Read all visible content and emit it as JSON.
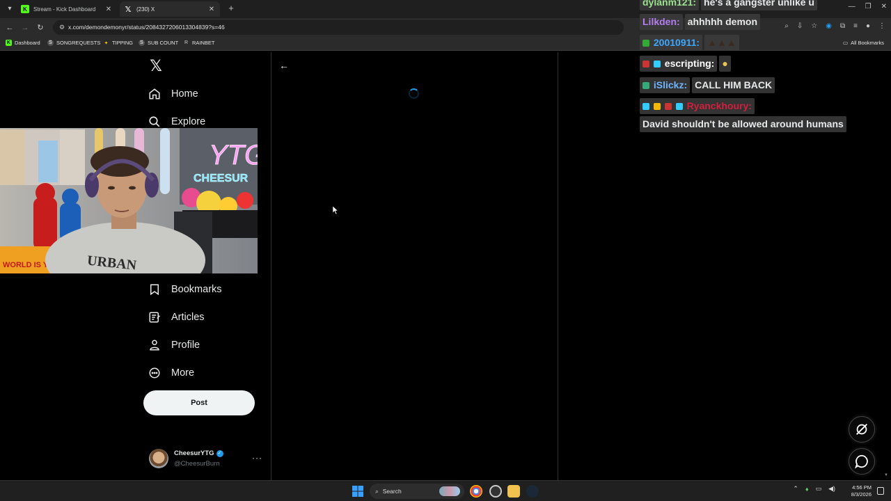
{
  "browser": {
    "tabs": [
      {
        "title": "Stream - Kick Dashboard",
        "favicon": "kick-icon",
        "active": false
      },
      {
        "title": "(230) X",
        "favicon": "x-logo-icon",
        "active": true
      }
    ],
    "url": "x.com/demondemonyr/status/2084327206013304839?s=46",
    "bookmarks": [
      "Dashboard",
      "SONGREQUESTS",
      "TIPPING",
      "SUB COUNT",
      "RAINBET"
    ],
    "all_bookmarks_label": "All Bookmarks"
  },
  "sidebar": {
    "nav": [
      {
        "label": "Home",
        "icon": "home-icon"
      },
      {
        "label": "Explore",
        "icon": "search-icon"
      },
      {
        "label": "Bookmarks",
        "icon": "bookmark-icon"
      },
      {
        "label": "Articles",
        "icon": "article-icon"
      },
      {
        "label": "Profile",
        "icon": "person-icon"
      },
      {
        "label": "More",
        "icon": "more-circle-icon"
      }
    ],
    "post_label": "Post",
    "account": {
      "name": "CheesurYTG",
      "handle": "@CheesurBurn"
    }
  },
  "webcam": {
    "neon_text": "YTG",
    "sign_text": "CHEESUR",
    "shirt_text": "URBAN",
    "poster_text": "WORLD IS Y"
  },
  "chat": [
    {
      "user": "dylanm121:",
      "message": "he's a gangster unlike u",
      "color": "#9be28f"
    },
    {
      "user": "Lilkden:",
      "message": "ahhhhh demon",
      "color": "#b57cf0"
    },
    {
      "user": "20010911:",
      "message": "",
      "color": "#3ea7ff"
    },
    {
      "user": "escripting:",
      "message": "",
      "color": "#ffffff"
    },
    {
      "user": "iSlickz:",
      "message": "CALL HIM BACK",
      "color": "#6fb4ff"
    },
    {
      "user": "Ryanckhoury:",
      "message": "David shouldn't be allowed around humans",
      "color": "#d21f3c"
    }
  ],
  "taskbar": {
    "search_label": "Search",
    "time": "4:56 PM",
    "date": "8/3/2026"
  },
  "colors": {
    "accent": "#1d9bf0",
    "kick_green": "#53fc18",
    "background": "#000000"
  }
}
